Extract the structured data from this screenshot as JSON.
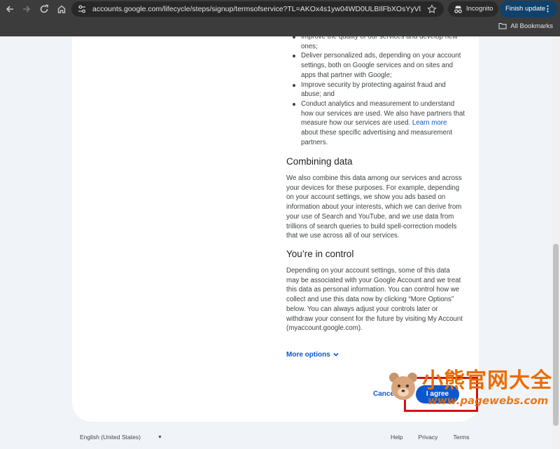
{
  "browser": {
    "url": "accounts.google.com/lifecycle/steps/signup/termsofservice?TL=AKOx4s1yw04WD0ULBIlFbXOsYyVl...",
    "incognito_label": "Incognito",
    "finish_update_label": "Finish update",
    "bookmarks_label": "All Bookmarks"
  },
  "terms": {
    "bullets": [
      {
        "text": "Improve the quality of our services and develop new ones;"
      },
      {
        "text": "Deliver personalized ads, depending on your account settings, both on Google services and on sites and apps that partner with Google;"
      },
      {
        "text": "Improve security by protecting against fraud and abuse; and"
      },
      {
        "text_before": "Conduct analytics and measurement to understand how our services are used. We also have partners that measure how our services are used. ",
        "link": "Learn more",
        "text_after": " about these specific advertising and measurement partners."
      }
    ],
    "combining_title": "Combining data",
    "combining_text": "We also combine this data among our services and across your devices for these purposes. For example, depending on your account settings, we show you ads based on information about your interests, which we can derive from your use of Search and YouTube, and we use data from trillions of search queries to build spell-correction models that we use across all of our services.",
    "control_title": "You’re in control",
    "control_text": "Depending on your account settings, some of this data may be associated with your Google Account and we treat this data as personal information. You can control how we collect and use this data now by clicking “More Options” below. You can always adjust your controls later or withdraw your consent for the future by visiting My Account (myaccount.google.com).",
    "more_options_label": "More options"
  },
  "actions": {
    "cancel_label": "Cancel",
    "agree_label": "I agree"
  },
  "footer": {
    "language": "English (United States)",
    "links": [
      "Help",
      "Privacy",
      "Terms"
    ]
  },
  "watermark": {
    "cn_text": "小熊官网大全",
    "en_text": "www.pagewebs.com"
  },
  "colors": {
    "link": "#0b57d0",
    "primary_button": "#0b57d0",
    "highlight_box": "#d40f14",
    "watermark": "#ec6b00"
  }
}
